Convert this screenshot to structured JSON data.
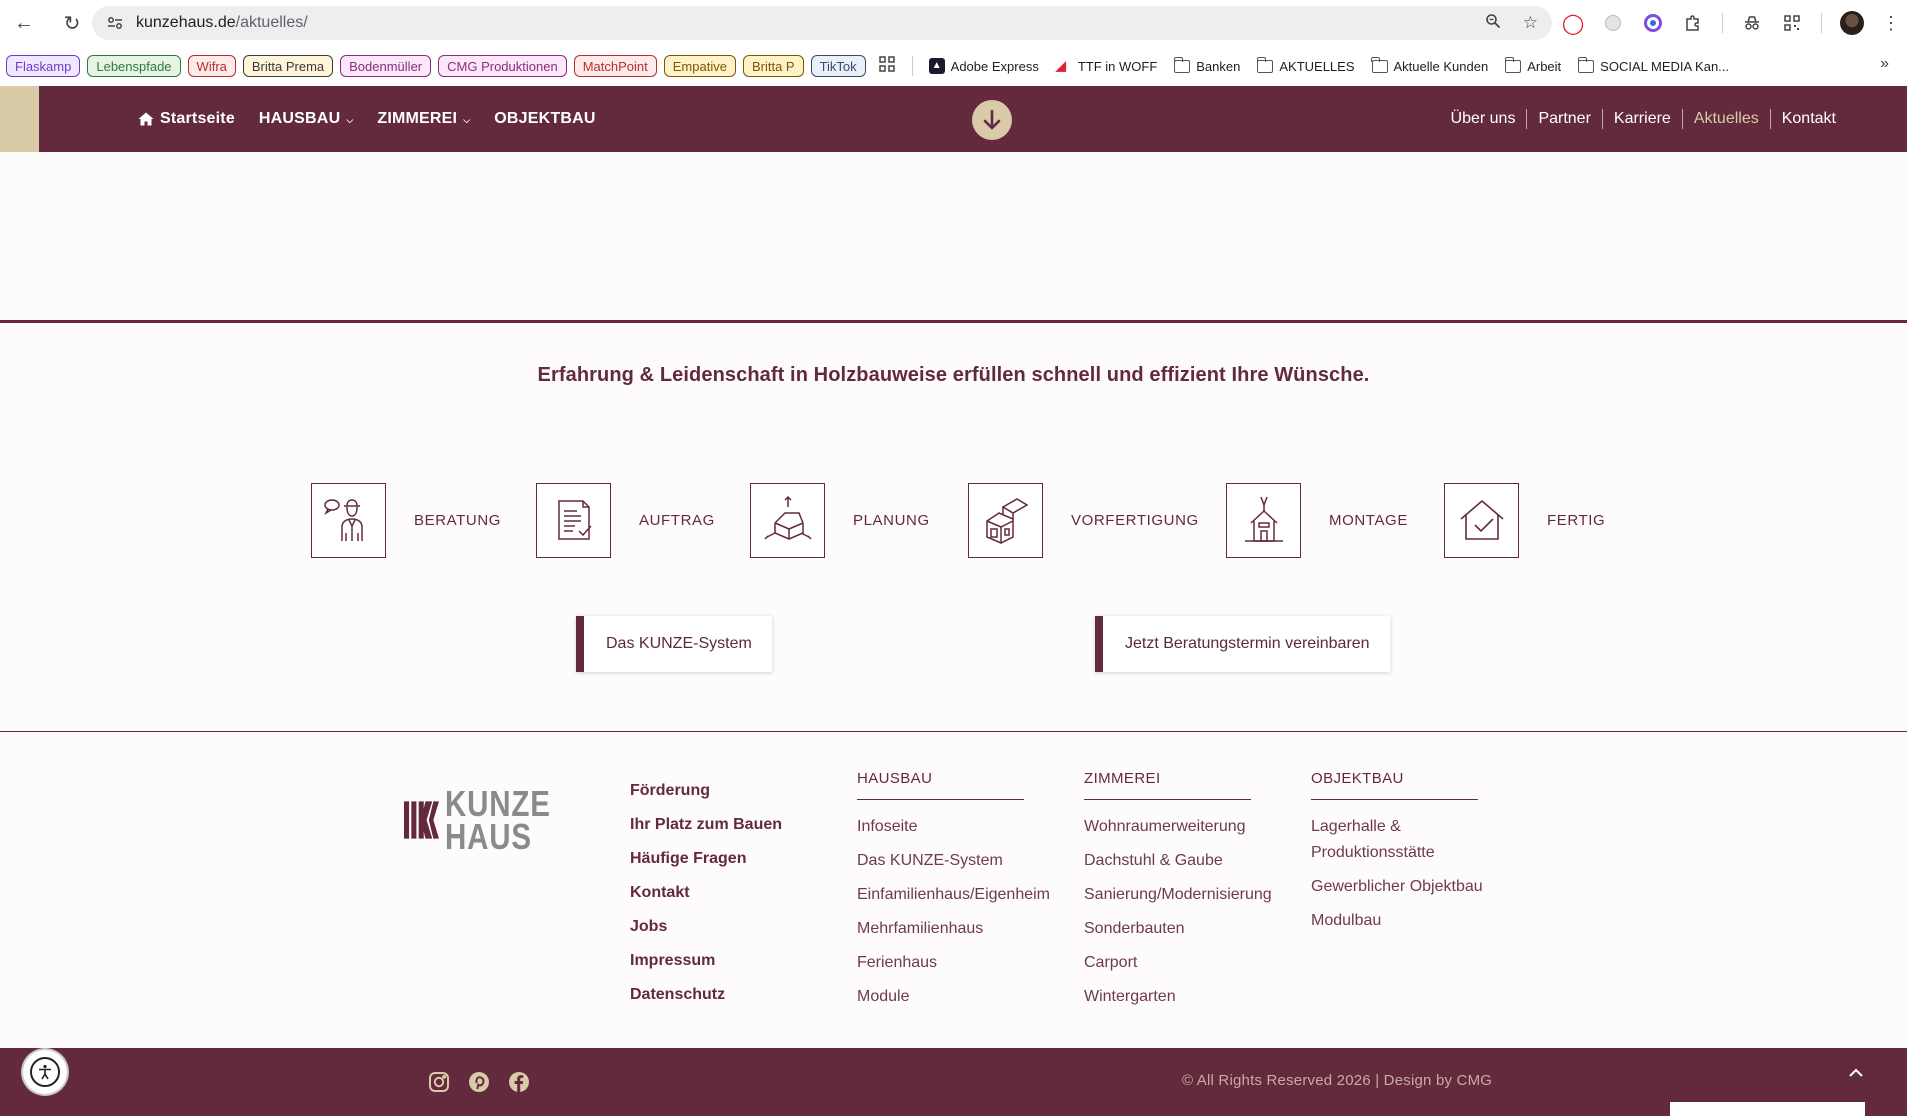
{
  "browser": {
    "url_host": "kunzehaus.de",
    "url_path": "/aktuelles/",
    "bookmarks_pills": [
      {
        "label": "Flaskamp",
        "color": "#6c3cd0",
        "bg": "#efe8ff"
      },
      {
        "label": "Lebenspfade",
        "color": "#2f7a3a",
        "bg": "#e6f4e6"
      },
      {
        "label": "Wifra",
        "color": "#b5302f",
        "bg": "#fdeaea"
      },
      {
        "label": "Britta Prema",
        "color": "#3a3a3a",
        "bg": "#fff5d8"
      },
      {
        "label": "Bodenmüller",
        "color": "#8a2d82",
        "bg": "#fbe7f8"
      },
      {
        "label": "CMG Produktionen",
        "color": "#8a2d82",
        "bg": "#fbe7f8"
      },
      {
        "label": "MatchPoint",
        "color": "#b5302f",
        "bg": "#fdeaea"
      },
      {
        "label": "Empative",
        "color": "#7a5a00",
        "bg": "#fff2c8"
      },
      {
        "label": "Britta P",
        "color": "#7a5a00",
        "bg": "#fff2c8"
      },
      {
        "label": "TikTok",
        "color": "#3a4a6a",
        "bg": "#eaf0f8"
      }
    ],
    "bookmarks_plain": [
      {
        "label": "Adobe Express",
        "icon": "adobe-express-icon"
      },
      {
        "label": "TTF in WOFF",
        "icon": "ttf-woff-icon"
      },
      {
        "label": "Banken",
        "icon": "folder-icon"
      },
      {
        "label": "AKTUELLES",
        "icon": "folder-icon"
      },
      {
        "label": "Aktuelle Kunden",
        "icon": "folder-icon"
      },
      {
        "label": "Arbeit",
        "icon": "folder-icon"
      },
      {
        "label": "SOCIAL MEDIA Kan...",
        "icon": "folder-icon"
      }
    ]
  },
  "header": {
    "home_label": "Startseite",
    "nav": [
      {
        "label": "HAUSBAU",
        "has_dropdown": true
      },
      {
        "label": "ZIMMEREI",
        "has_dropdown": true
      },
      {
        "label": "OBJEKTBAU",
        "has_dropdown": false
      }
    ],
    "secondary": [
      {
        "label": "Über uns",
        "active": false
      },
      {
        "label": "Partner",
        "active": false
      },
      {
        "label": "Karriere",
        "active": false
      },
      {
        "label": "Aktuelles",
        "active": true
      },
      {
        "label": "Kontakt",
        "active": false
      }
    ],
    "scroll_icon": "arrow-down-icon"
  },
  "content": {
    "tagline": "Erfahrung & Leidenschaft in Holzbauweise erfüllen schnell und effizient Ihre Wünsche.",
    "steps": [
      {
        "label": "BERATUNG",
        "icon": "consultation-icon"
      },
      {
        "label": "AUFTRAG",
        "icon": "contract-icon"
      },
      {
        "label": "PLANUNG",
        "icon": "planning-icon"
      },
      {
        "label": "VORFERTIGUNG",
        "icon": "prefabrication-icon"
      },
      {
        "label": "MONTAGE",
        "icon": "assembly-icon"
      },
      {
        "label": "FERTIG",
        "icon": "finished-house-icon"
      }
    ],
    "cta_system": "Das KUNZE-System",
    "cta_appointment": "Jetzt Beratungstermin vereinbaren"
  },
  "footer": {
    "logo_line1": "KUNZE",
    "logo_line2": "HAUS",
    "quick_links": [
      "Förderung",
      "Ihr Platz zum Bauen",
      "Häufige Fragen",
      "Kontakt",
      "Jobs",
      "Impressum",
      "Datenschutz"
    ],
    "columns": [
      {
        "title": "HAUSBAU",
        "links": [
          "Infoseite",
          "Das KUNZE-System",
          "Einfamilienhaus/Eigenheim",
          "Mehrfamilienhaus",
          "Ferienhaus",
          "Module"
        ]
      },
      {
        "title": "ZIMMEREI",
        "links": [
          "Wohnraumerweiterung",
          "Dachstuhl & Gaube",
          "Sanierung/Modernisierung",
          "Sonderbauten",
          "Carport",
          "Wintergarten"
        ]
      },
      {
        "title": "OBJEKTBAU",
        "links": [
          "Lagerhalle & Produktionsstätte",
          "Gewerblicher Objektbau",
          "Modulbau"
        ]
      }
    ],
    "copyright": "© All Rights Reserved 2026 | Design by CMG",
    "socials": [
      "instagram-icon",
      "pinterest-icon",
      "facebook-icon"
    ]
  },
  "colors": {
    "brand": "#632a3d",
    "accent": "#d9cba7"
  }
}
